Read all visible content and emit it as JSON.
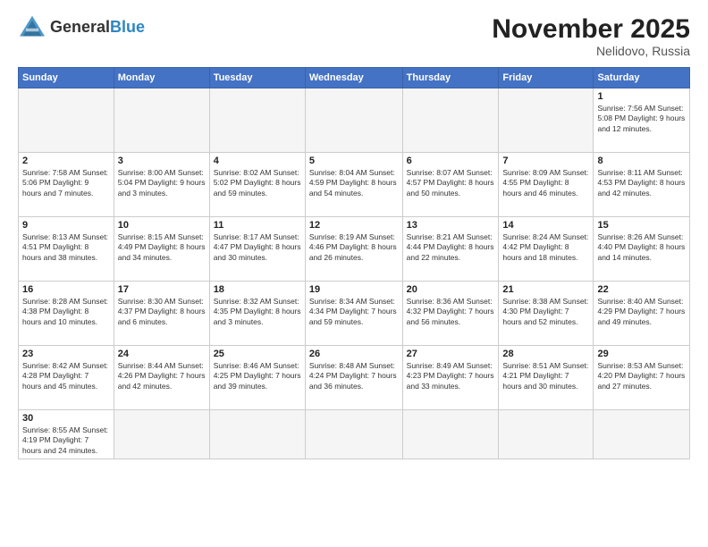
{
  "header": {
    "logo_general": "General",
    "logo_blue": "Blue",
    "title": "November 2025",
    "subtitle": "Nelidovo, Russia"
  },
  "weekdays": [
    "Sunday",
    "Monday",
    "Tuesday",
    "Wednesday",
    "Thursday",
    "Friday",
    "Saturday"
  ],
  "weeks": [
    [
      {
        "day": "",
        "info": ""
      },
      {
        "day": "",
        "info": ""
      },
      {
        "day": "",
        "info": ""
      },
      {
        "day": "",
        "info": ""
      },
      {
        "day": "",
        "info": ""
      },
      {
        "day": "",
        "info": ""
      },
      {
        "day": "1",
        "info": "Sunrise: 7:56 AM\nSunset: 5:08 PM\nDaylight: 9 hours and 12 minutes."
      }
    ],
    [
      {
        "day": "2",
        "info": "Sunrise: 7:58 AM\nSunset: 5:06 PM\nDaylight: 9 hours and 7 minutes."
      },
      {
        "day": "3",
        "info": "Sunrise: 8:00 AM\nSunset: 5:04 PM\nDaylight: 9 hours and 3 minutes."
      },
      {
        "day": "4",
        "info": "Sunrise: 8:02 AM\nSunset: 5:02 PM\nDaylight: 8 hours and 59 minutes."
      },
      {
        "day": "5",
        "info": "Sunrise: 8:04 AM\nSunset: 4:59 PM\nDaylight: 8 hours and 54 minutes."
      },
      {
        "day": "6",
        "info": "Sunrise: 8:07 AM\nSunset: 4:57 PM\nDaylight: 8 hours and 50 minutes."
      },
      {
        "day": "7",
        "info": "Sunrise: 8:09 AM\nSunset: 4:55 PM\nDaylight: 8 hours and 46 minutes."
      },
      {
        "day": "8",
        "info": "Sunrise: 8:11 AM\nSunset: 4:53 PM\nDaylight: 8 hours and 42 minutes."
      }
    ],
    [
      {
        "day": "9",
        "info": "Sunrise: 8:13 AM\nSunset: 4:51 PM\nDaylight: 8 hours and 38 minutes."
      },
      {
        "day": "10",
        "info": "Sunrise: 8:15 AM\nSunset: 4:49 PM\nDaylight: 8 hours and 34 minutes."
      },
      {
        "day": "11",
        "info": "Sunrise: 8:17 AM\nSunset: 4:47 PM\nDaylight: 8 hours and 30 minutes."
      },
      {
        "day": "12",
        "info": "Sunrise: 8:19 AM\nSunset: 4:46 PM\nDaylight: 8 hours and 26 minutes."
      },
      {
        "day": "13",
        "info": "Sunrise: 8:21 AM\nSunset: 4:44 PM\nDaylight: 8 hours and 22 minutes."
      },
      {
        "day": "14",
        "info": "Sunrise: 8:24 AM\nSunset: 4:42 PM\nDaylight: 8 hours and 18 minutes."
      },
      {
        "day": "15",
        "info": "Sunrise: 8:26 AM\nSunset: 4:40 PM\nDaylight: 8 hours and 14 minutes."
      }
    ],
    [
      {
        "day": "16",
        "info": "Sunrise: 8:28 AM\nSunset: 4:38 PM\nDaylight: 8 hours and 10 minutes."
      },
      {
        "day": "17",
        "info": "Sunrise: 8:30 AM\nSunset: 4:37 PM\nDaylight: 8 hours and 6 minutes."
      },
      {
        "day": "18",
        "info": "Sunrise: 8:32 AM\nSunset: 4:35 PM\nDaylight: 8 hours and 3 minutes."
      },
      {
        "day": "19",
        "info": "Sunrise: 8:34 AM\nSunset: 4:34 PM\nDaylight: 7 hours and 59 minutes."
      },
      {
        "day": "20",
        "info": "Sunrise: 8:36 AM\nSunset: 4:32 PM\nDaylight: 7 hours and 56 minutes."
      },
      {
        "day": "21",
        "info": "Sunrise: 8:38 AM\nSunset: 4:30 PM\nDaylight: 7 hours and 52 minutes."
      },
      {
        "day": "22",
        "info": "Sunrise: 8:40 AM\nSunset: 4:29 PM\nDaylight: 7 hours and 49 minutes."
      }
    ],
    [
      {
        "day": "23",
        "info": "Sunrise: 8:42 AM\nSunset: 4:28 PM\nDaylight: 7 hours and 45 minutes."
      },
      {
        "day": "24",
        "info": "Sunrise: 8:44 AM\nSunset: 4:26 PM\nDaylight: 7 hours and 42 minutes."
      },
      {
        "day": "25",
        "info": "Sunrise: 8:46 AM\nSunset: 4:25 PM\nDaylight: 7 hours and 39 minutes."
      },
      {
        "day": "26",
        "info": "Sunrise: 8:48 AM\nSunset: 4:24 PM\nDaylight: 7 hours and 36 minutes."
      },
      {
        "day": "27",
        "info": "Sunrise: 8:49 AM\nSunset: 4:23 PM\nDaylight: 7 hours and 33 minutes."
      },
      {
        "day": "28",
        "info": "Sunrise: 8:51 AM\nSunset: 4:21 PM\nDaylight: 7 hours and 30 minutes."
      },
      {
        "day": "29",
        "info": "Sunrise: 8:53 AM\nSunset: 4:20 PM\nDaylight: 7 hours and 27 minutes."
      }
    ],
    [
      {
        "day": "30",
        "info": "Sunrise: 8:55 AM\nSunset: 4:19 PM\nDaylight: 7 hours and 24 minutes."
      },
      {
        "day": "",
        "info": ""
      },
      {
        "day": "",
        "info": ""
      },
      {
        "day": "",
        "info": ""
      },
      {
        "day": "",
        "info": ""
      },
      {
        "day": "",
        "info": ""
      },
      {
        "day": "",
        "info": ""
      }
    ]
  ]
}
